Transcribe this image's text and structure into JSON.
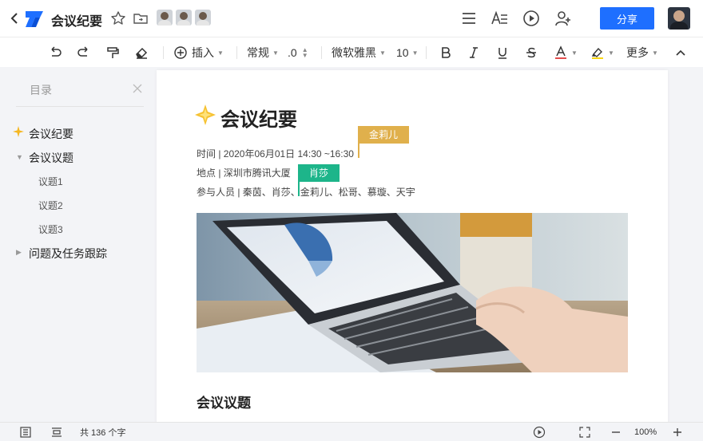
{
  "header": {
    "title": "会议纪要",
    "share_label": "分享"
  },
  "toolbar": {
    "insert_label": "插入",
    "style_label": "常规",
    "spacing_label": ".0",
    "font_label": "微软雅黑",
    "size_label": "10",
    "more_label": "更多",
    "underline_color": "#e34d4d",
    "highlight_color": "#f7d511"
  },
  "sidebar": {
    "title": "目录",
    "items": [
      {
        "label": "会议纪要"
      },
      {
        "label": "会议议题"
      },
      {
        "label": "议题1"
      },
      {
        "label": "议题2"
      },
      {
        "label": "议题3"
      },
      {
        "label": "问题及任务跟踪"
      }
    ]
  },
  "document": {
    "heading": "会议纪要",
    "time_line": "时间 | 2020年06月01日  14:30 ~16:30",
    "place_line": "地点 | 深圳市腾讯大厦",
    "attendees_line": "参与人员 | 秦茵、肖莎、金莉儿、松哥、慕璇、天宇",
    "section_heading": "会议议题",
    "collaborators": [
      {
        "name": "金莉儿",
        "color": "#e0b04c"
      },
      {
        "name": "肖莎",
        "color": "#1db58a"
      }
    ]
  },
  "statusbar": {
    "word_count": "共 136 个字",
    "zoom": "100%"
  },
  "colors": {
    "accent": "#1e6fff"
  }
}
